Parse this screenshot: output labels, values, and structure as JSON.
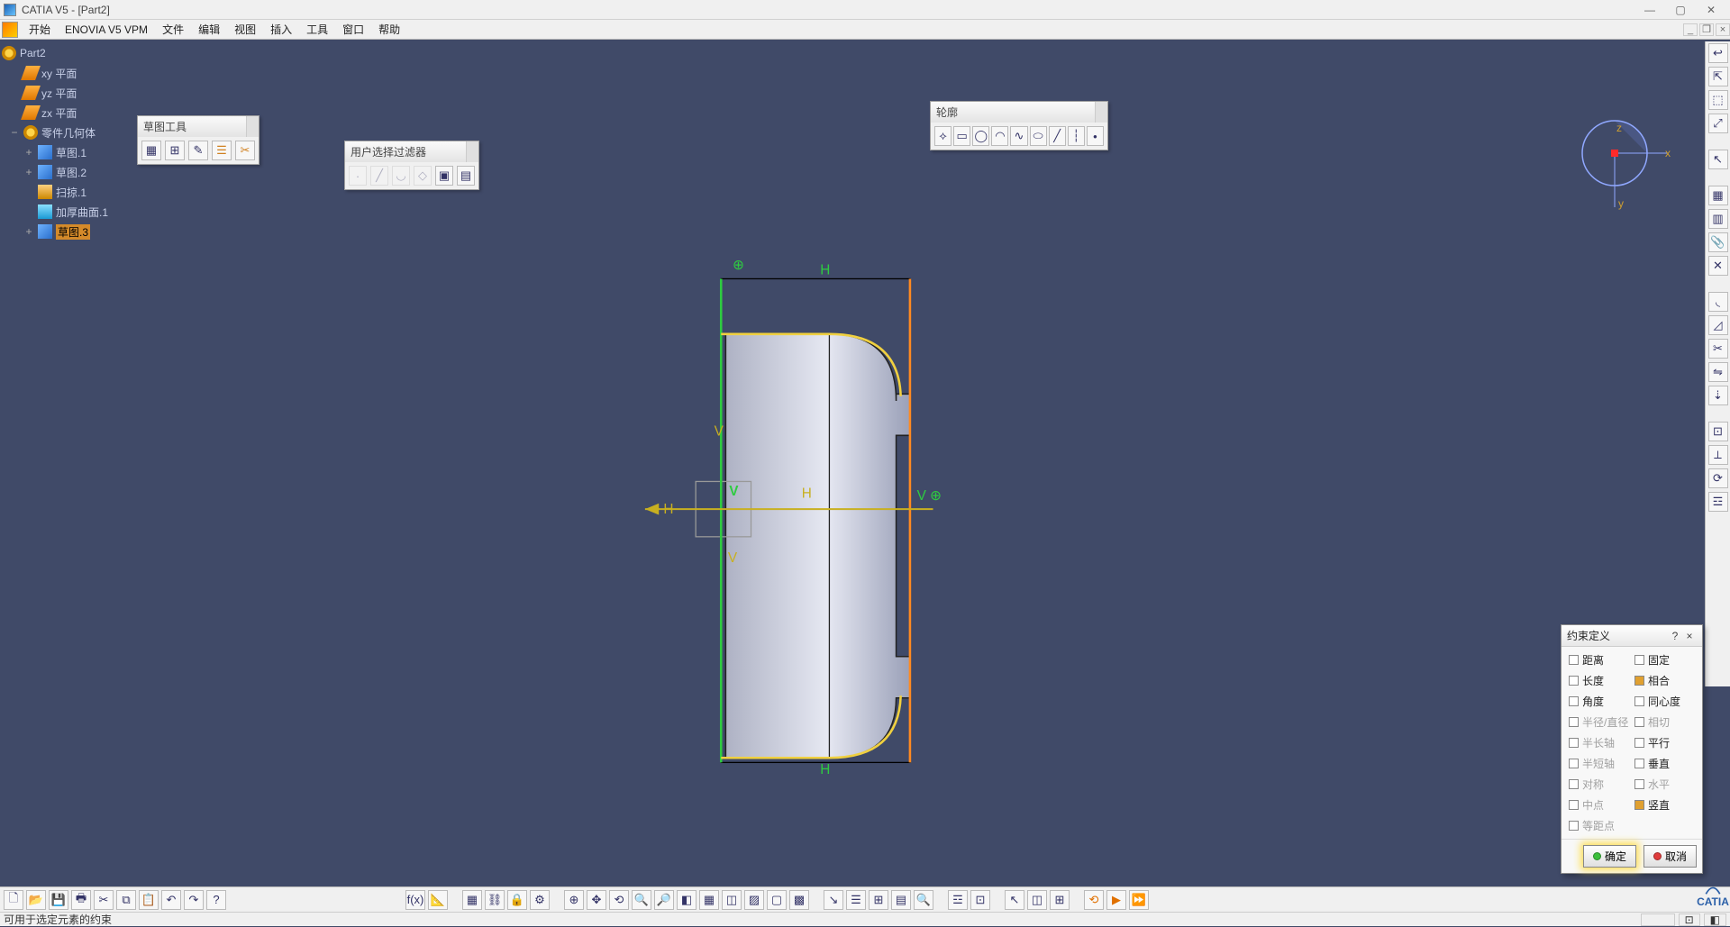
{
  "title": "CATIA V5 - [Part2]",
  "menu": [
    "开始",
    "ENOVIA V5 VPM",
    "文件",
    "编辑",
    "视图",
    "插入",
    "工具",
    "窗口",
    "帮助"
  ],
  "tree": {
    "root": "Part2",
    "items": [
      {
        "label": "xy 平面",
        "icon": "plane"
      },
      {
        "label": "yz 平面",
        "icon": "plane"
      },
      {
        "label": "zx 平面",
        "icon": "plane"
      },
      {
        "label": "零件几何体",
        "icon": "gear",
        "exp": "−"
      },
      {
        "label": "草图.1",
        "icon": "sk",
        "indent": 1,
        "exp": "+"
      },
      {
        "label": "草图.2",
        "icon": "sk",
        "indent": 1,
        "exp": "+"
      },
      {
        "label": "扫掠.1",
        "icon": "sw",
        "indent": 1
      },
      {
        "label": "加厚曲面.1",
        "icon": "th",
        "indent": 1
      },
      {
        "label": "草图.3",
        "icon": "sk",
        "indent": 1,
        "exp": "+",
        "sel": true
      }
    ]
  },
  "toolbars": {
    "sketch": {
      "title": "草图工具",
      "icons": [
        "grid-icon",
        "snap-icon",
        "construction-icon",
        "dim-icon",
        "trim-icon"
      ]
    },
    "filter": {
      "title": "用户选择过滤器",
      "icons": [
        "pt",
        "ln",
        "cv",
        "fc",
        "bd",
        "ot"
      ]
    },
    "profile": {
      "title": "轮廓",
      "icons": [
        "profile-icon",
        "rect-icon",
        "circle-icon",
        "arc-icon",
        "spline-icon",
        "ellipse-icon",
        "line-icon",
        "axis-icon",
        "point-icon"
      ]
    }
  },
  "dialog": {
    "title": "约束定义",
    "rows": [
      [
        "距离",
        false,
        false,
        "固定",
        false,
        false
      ],
      [
        "长度",
        false,
        false,
        "相合",
        true,
        false
      ],
      [
        "角度",
        false,
        false,
        "同心度",
        false,
        false
      ],
      [
        "半径/直径",
        false,
        true,
        "相切",
        false,
        true
      ],
      [
        "半长轴",
        false,
        true,
        "平行",
        false,
        false
      ],
      [
        "半短轴",
        false,
        true,
        "垂直",
        false,
        false
      ],
      [
        "对称",
        false,
        true,
        "水平",
        false,
        true
      ],
      [
        "中点",
        false,
        true,
        "竖直",
        true,
        false
      ],
      [
        "等距点",
        false,
        true,
        "",
        false,
        true
      ]
    ],
    "ok": "确定",
    "cancel": "取消",
    "help": "?",
    "close": "×"
  },
  "status": "可用于选定元素的约束",
  "compass": {
    "x": "x",
    "y": "y",
    "z": "z"
  },
  "axes": {
    "h": "H",
    "v": "V"
  }
}
